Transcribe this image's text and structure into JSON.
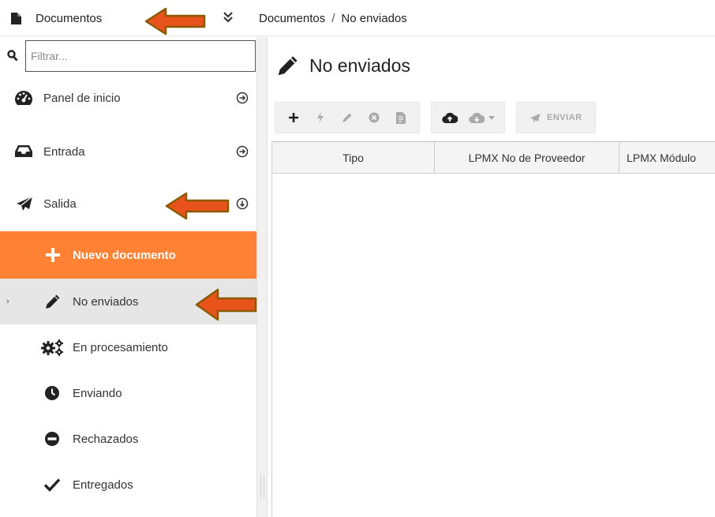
{
  "header": {
    "app_title": "Documentos",
    "breadcrumb": [
      "Documentos",
      "No enviados"
    ],
    "breadcrumb_separator": "/"
  },
  "sidebar": {
    "filter_placeholder": "Filtrar...",
    "items": [
      {
        "label": "Panel de inicio",
        "icon": "dashboard-icon",
        "chevron": "arrow-right-circle-icon"
      },
      {
        "label": "Entrada",
        "icon": "inbox-icon",
        "chevron": "arrow-right-circle-icon"
      },
      {
        "label": "Salida",
        "icon": "paper-plane-icon",
        "chevron": "arrow-down-circle-icon"
      },
      {
        "label": "Nuevo documento",
        "icon": "plus-icon",
        "state": "active"
      },
      {
        "label": "No enviados",
        "icon": "pencil-icon",
        "state": "selected"
      },
      {
        "label": "En procesamiento",
        "icon": "cogs-icon"
      },
      {
        "label": "Enviando",
        "icon": "clock-icon"
      },
      {
        "label": "Rechazados",
        "icon": "minus-circle-icon"
      },
      {
        "label": "Entregados",
        "icon": "check-icon"
      }
    ],
    "selection_marker": "›"
  },
  "main": {
    "title": "No enviados",
    "title_icon": "pencil-icon",
    "toolbar": {
      "send_label": "ENVIAR"
    },
    "table": {
      "columns": [
        "Tipo",
        "LPMX No de Proveedor",
        "LPMX Módulo"
      ]
    }
  },
  "colors": {
    "accent": "#ff8133",
    "selected_bg": "#e6e6e6",
    "arrow_fill": "#e8531c",
    "arrow_stroke": "#8a5a00"
  }
}
